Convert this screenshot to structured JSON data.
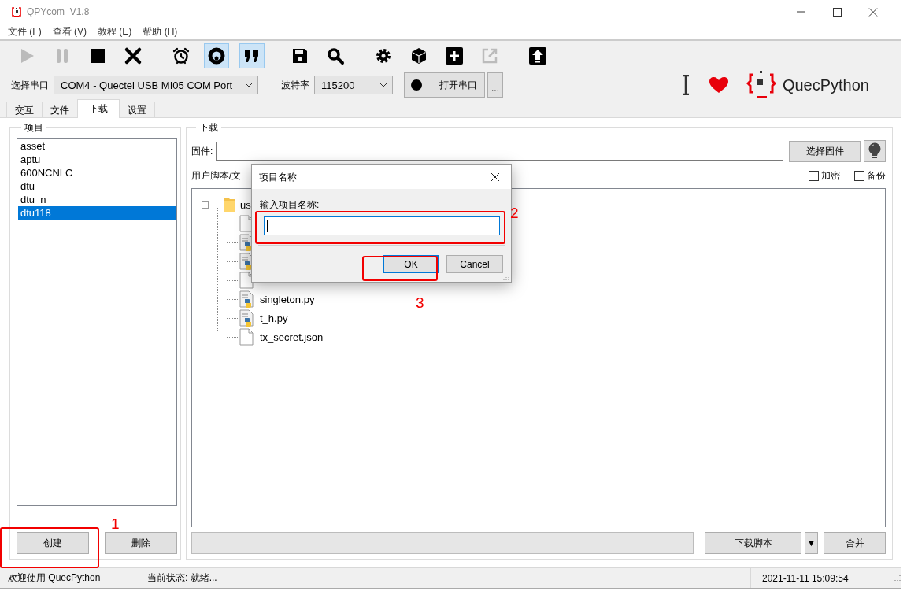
{
  "window": {
    "title": "QPYcom_V1.8"
  },
  "menu": [
    "文件 (F)",
    "查看 (V)",
    "教程 (E)",
    "帮助 (H)"
  ],
  "toolbar": [
    [
      {
        "kind": "play",
        "disabled": true,
        "selected": false
      },
      {
        "kind": "pause",
        "disabled": true,
        "selected": false
      },
      {
        "kind": "stop",
        "disabled": false,
        "selected": false
      },
      {
        "kind": "close",
        "disabled": false,
        "selected": false
      }
    ],
    [
      {
        "kind": "alarm",
        "disabled": false,
        "selected": false
      },
      {
        "kind": "ring",
        "disabled": false,
        "selected": true
      },
      {
        "kind": "quote",
        "disabled": false,
        "selected": true
      }
    ],
    [
      {
        "kind": "save",
        "disabled": false,
        "selected": false
      },
      {
        "kind": "search",
        "disabled": false,
        "selected": false
      }
    ],
    [
      {
        "kind": "gear",
        "disabled": false,
        "selected": false
      },
      {
        "kind": "cube",
        "disabled": false,
        "selected": false
      },
      {
        "kind": "plus",
        "disabled": false,
        "selected": false
      },
      {
        "kind": "export",
        "disabled": true,
        "selected": false
      }
    ],
    [
      {
        "kind": "upload",
        "disabled": false,
        "selected": false
      }
    ]
  ],
  "serial": {
    "port_label": "选择串口",
    "port": "COM4 - Quectel USB MI05 COM Port",
    "baud_label": "波特率",
    "baud": "115200",
    "open_button": "打开串口",
    "more_button": "..."
  },
  "branding": {
    "name": "QuecPython"
  },
  "tabs": [
    {
      "label": "交互",
      "selected": false
    },
    {
      "label": "文件",
      "selected": false
    },
    {
      "label": "下载",
      "selected": true
    },
    {
      "label": "设置",
      "selected": false
    }
  ],
  "projects": {
    "title": "项目",
    "items": [
      {
        "label": "asset",
        "selected": false
      },
      {
        "label": "aptu",
        "selected": false
      },
      {
        "label": "600NCNLC",
        "selected": false
      },
      {
        "label": "dtu",
        "selected": false
      },
      {
        "label": "dtu_n",
        "selected": false
      },
      {
        "label": "dtu118",
        "selected": true
      }
    ],
    "buttons": [
      "创建",
      "删除"
    ]
  },
  "download": {
    "title": "下载",
    "firmware_label": "固件:",
    "choose_button": "选择固件",
    "scripts_label": "用户脚本/文",
    "options": [
      {
        "label": "加密",
        "checked": false
      },
      {
        "label": "备份",
        "checked": false
      }
    ],
    "tree": {
      "label": "us",
      "expanded": true,
      "children": [
        {
          "kind": "file"
        },
        {
          "kind": "python"
        },
        {
          "kind": "python"
        },
        {
          "kind": "file"
        },
        {
          "kind": "python",
          "label": "singleton.py"
        },
        {
          "kind": "python",
          "label": "t_h.py"
        },
        {
          "kind": "file",
          "label": "tx_secret.json"
        }
      ]
    },
    "progress": {
      "level": 0
    },
    "download_button": "下载脚本",
    "dropdown_button": "▼",
    "merge_button": "合并"
  },
  "status_bar": [
    "欢迎使用 QuecPython",
    "当前状态: 就绪...",
    "2021-11-11 15:09:54"
  ],
  "dialog": {
    "title": "项目名称",
    "prompt": "输入项目名称:",
    "buttons": [
      {
        "label": "OK",
        "default": true
      },
      {
        "label": "Cancel",
        "default": false
      }
    ]
  },
  "annotations": [
    "1",
    "2",
    "3"
  ]
}
